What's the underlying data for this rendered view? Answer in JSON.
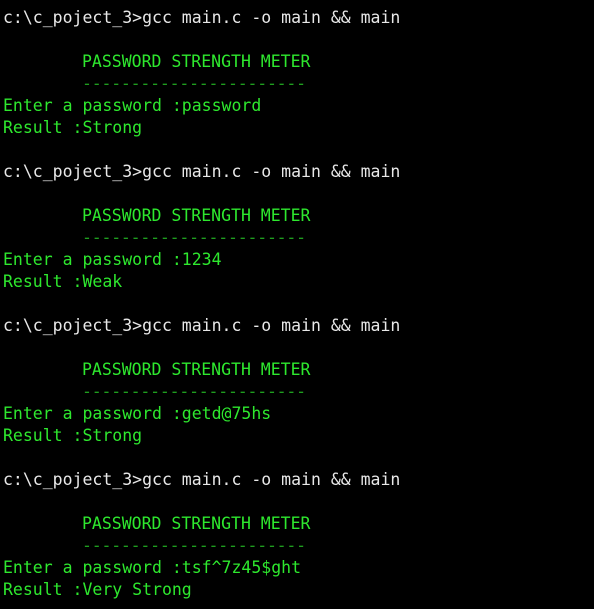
{
  "terminal": {
    "colors": {
      "background": "#000000",
      "prompt_text": "#e8e8e8",
      "program_text": "#2ee82e",
      "dashes": "#1f9e1f"
    },
    "runs": [
      {
        "command": "c:\\c_poject_3>gcc main.c -o main && main",
        "title": "PASSWORD STRENGTH METER",
        "divider": "-----------------------",
        "input_line": "Enter a password :password",
        "result_line": "Result :Strong"
      },
      {
        "command": "c:\\c_poject_3>gcc main.c -o main && main",
        "title": "PASSWORD STRENGTH METER",
        "divider": "-----------------------",
        "input_line": "Enter a password :1234",
        "result_line": "Result :Weak"
      },
      {
        "command": "c:\\c_poject_3>gcc main.c -o main && main",
        "title": "PASSWORD STRENGTH METER",
        "divider": "-----------------------",
        "input_line": "Enter a password :getd@75hs",
        "result_line": "Result :Strong"
      },
      {
        "command": "c:\\c_poject_3>gcc main.c -o main && main",
        "title": "PASSWORD STRENGTH METER",
        "divider": "-----------------------",
        "input_line": "Enter a password :tsf^7z45$ght",
        "result_line": "Result :Very Strong"
      }
    ]
  }
}
